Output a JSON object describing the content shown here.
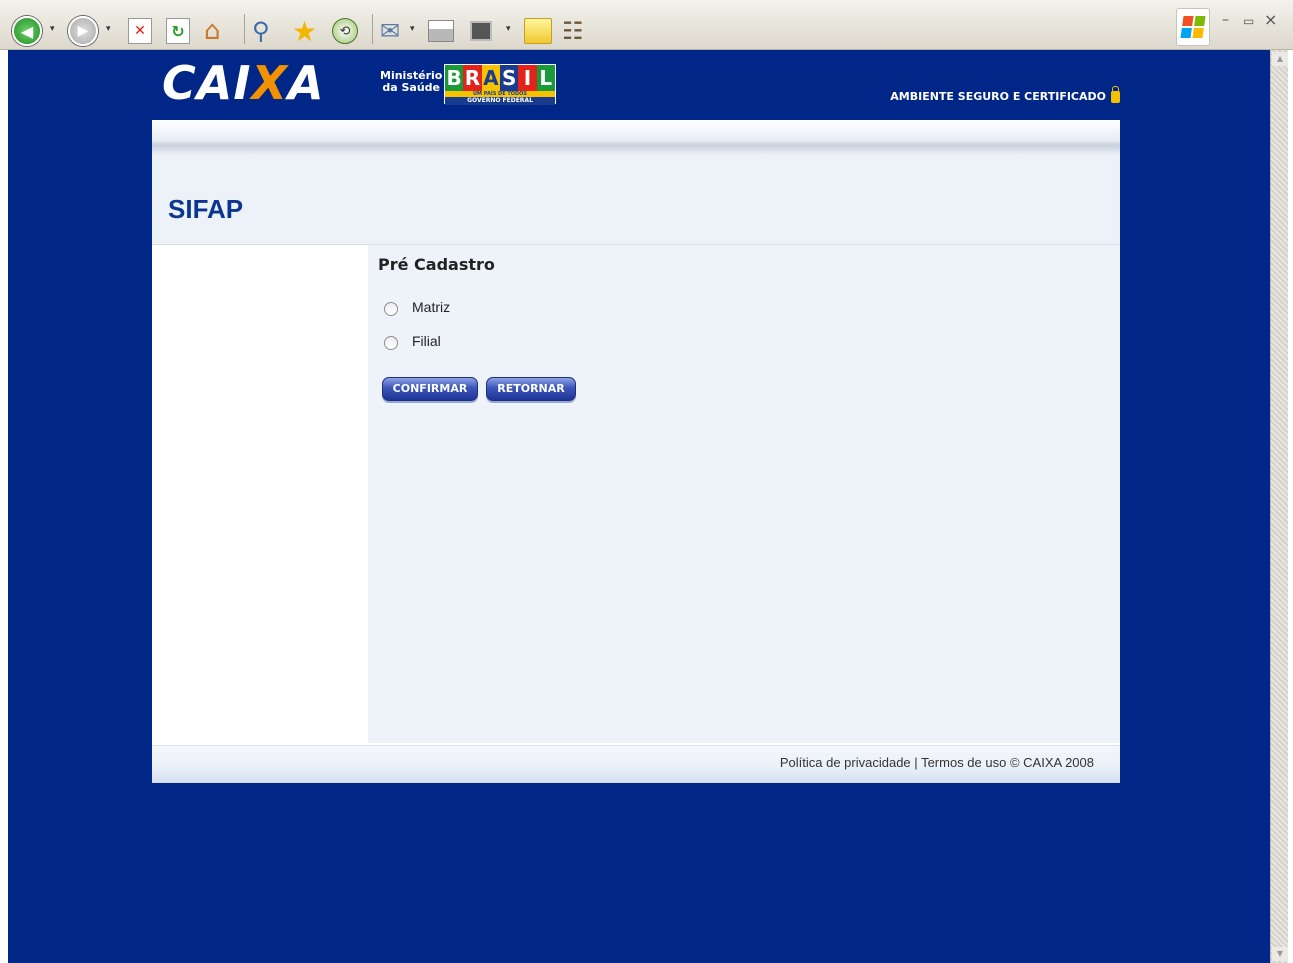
{
  "browser": {
    "toolbar_icons": [
      "back-icon",
      "forward-icon",
      "stop-icon",
      "refresh-icon",
      "home-icon",
      "search-icon",
      "favorites-icon",
      "history-icon",
      "mail-icon",
      "print-icon",
      "edit-icon",
      "notes-icon",
      "research-icon"
    ],
    "window_controls": {
      "minimize": "–",
      "restore": "▭",
      "close": "×"
    }
  },
  "header": {
    "logo": "CAIXA",
    "ministerio_line1": "Ministério",
    "ministerio_line2": "da Saúde",
    "brasil_logo": "BRASIL",
    "brasil_tagline": "UM PAÍS DE TODOS",
    "brasil_gov": "GOVERNO FEDERAL",
    "security_label": "AMBIENTE SEGURO E CERTIFICADO"
  },
  "page": {
    "title": "SIFAP",
    "section_title": "Pré Cadastro",
    "options": [
      {
        "label": "Matriz",
        "selected": false
      },
      {
        "label": "Filial",
        "selected": false
      }
    ],
    "confirm_label": "CONFIRMAR",
    "return_label": "RETORNAR"
  },
  "footer": {
    "privacy": "Política de privacidade",
    "separator": "|",
    "terms": "Termos de uso",
    "copyright": "© CAIXA 2008"
  },
  "colors": {
    "page_background": "#002788",
    "accent_orange": "#f39200",
    "title_blue": "#0b3690",
    "button_blue": "#2a44a8"
  }
}
